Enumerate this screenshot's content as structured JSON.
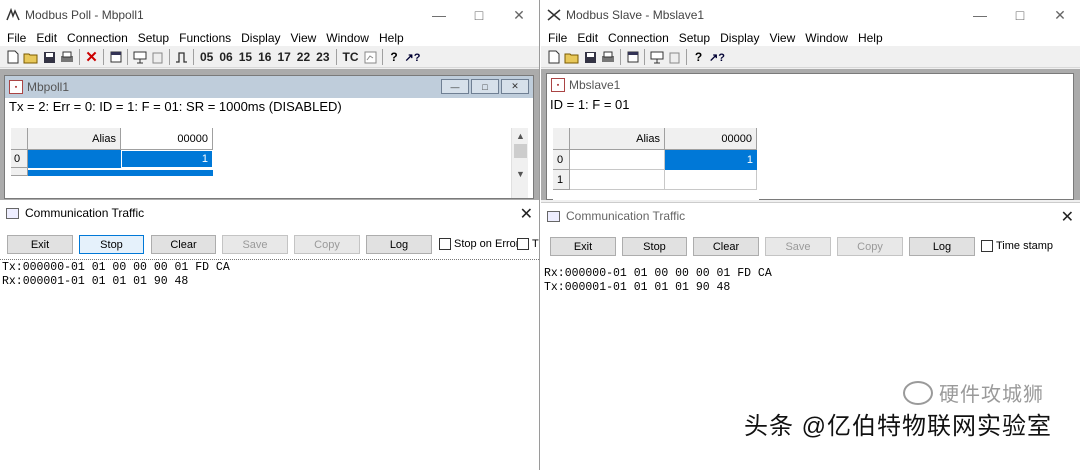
{
  "left": {
    "window_title": "Modbus Poll - Mbpoll1",
    "menu": [
      "File",
      "Edit",
      "Connection",
      "Setup",
      "Functions",
      "Display",
      "View",
      "Window",
      "Help"
    ],
    "toolbar_codes": [
      "05",
      "06",
      "15",
      "16",
      "17",
      "22",
      "23"
    ],
    "toolbar_tc": "TC",
    "child_title": "Mbpoll1",
    "status_line": "Tx = 2: Err = 0: ID = 1: F = 01: SR = 1000ms  (DISABLED)",
    "grid": {
      "alias_header": "Alias",
      "addr_header": "00000",
      "row0_index": "0",
      "row0_value": "1"
    },
    "traffic": {
      "title": "Communication Traffic",
      "buttons": [
        "Exit",
        "Stop",
        "Clear",
        "Save",
        "Copy",
        "Log"
      ],
      "stop_on_error": "Stop on Error",
      "cut_check": "Ti",
      "lines": [
        "Tx:000000-01 01 00 00 00 01 FD CA",
        "Rx:000001-01 01 01 01 90 48"
      ]
    }
  },
  "right": {
    "window_title": "Modbus Slave - Mbslave1",
    "menu": [
      "File",
      "Edit",
      "Connection",
      "Setup",
      "Display",
      "View",
      "Window",
      "Help"
    ],
    "child_title": "Mbslave1",
    "status_line": "ID = 1: F = 01",
    "grid": {
      "alias_header": "Alias",
      "addr_header": "00000",
      "row0_index": "0",
      "row0_value": "1",
      "row1_index": "1"
    },
    "traffic": {
      "title": "Communication Traffic",
      "buttons": [
        "Exit",
        "Stop",
        "Clear",
        "Save",
        "Copy",
        "Log"
      ],
      "time_stamp": "Time stamp",
      "lines": [
        "Rx:000000-01 01 00 00 00 01 FD CA",
        "Tx:000001-01 01 01 01 90 48"
      ]
    }
  },
  "watermark": {
    "line1": "硬件攻城狮",
    "line2": "头条 @亿伯特物联网实验室"
  },
  "colors": {
    "selection": "#0078d7",
    "mdi_background": "#ababab",
    "focus_border": "#0078d7"
  }
}
